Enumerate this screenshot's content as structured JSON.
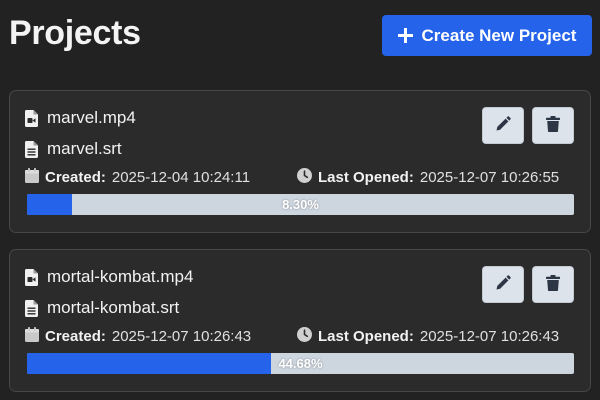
{
  "header": {
    "title": "Projects",
    "create_label": "Create New Project"
  },
  "colors": {
    "accent": "#2563eb",
    "background": "#222222",
    "card": "#2b2b2b",
    "progress_track": "#cdd5df",
    "icon_button": "#dde3ea"
  },
  "projects": [
    {
      "video_file": "marvel.mp4",
      "subtitle_file": "marvel.srt",
      "created_label": "Created:",
      "created": "2025-12-04 10:24:11",
      "opened_label": "Last Opened:",
      "opened": "2025-12-07 10:26:55",
      "progress": 8.3,
      "progress_label": "8.30%"
    },
    {
      "video_file": "mortal-kombat.mp4",
      "subtitle_file": "mortal-kombat.srt",
      "created_label": "Created:",
      "created": "2025-12-07 10:26:43",
      "opened_label": "Last Opened:",
      "opened": "2025-12-07 10:26:43",
      "progress": 44.68,
      "progress_label": "44.68%"
    }
  ],
  "icons": {
    "create": "plus-icon",
    "video": "video-file-icon",
    "subtitle": "text-file-icon",
    "created": "calendar-icon",
    "opened": "clock-icon",
    "edit": "pencil-icon",
    "delete": "trash-icon"
  }
}
